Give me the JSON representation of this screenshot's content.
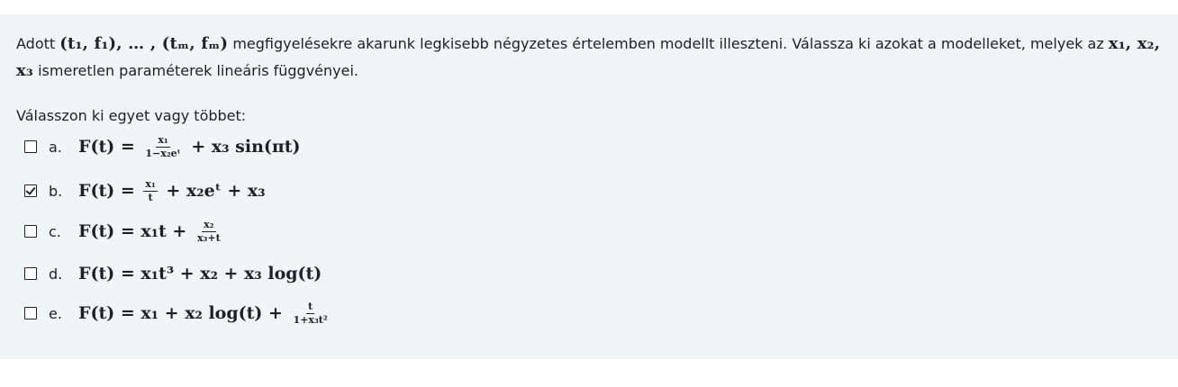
{
  "question": {
    "text_before": "Adott ",
    "math_observations": "(t₁, f₁), … , (tₘ, fₘ)",
    "text_middle": " megfigyelésekre akarunk legkisebb négyzetes értelemben modellt illeszteni. Válassza ki azokat a modelleket, melyek az ",
    "math_params": "x₁, x₂, x₃",
    "text_after": " ismeretlen paraméterek lineáris függvényei.",
    "instruction": "Válasszon ki egyet vagy többet:"
  },
  "options": [
    {
      "label": "a.",
      "checked": false,
      "lhs": "F(t) = ",
      "frac_num": "x₁",
      "frac_den": "1−x₂eᵗ",
      "rest": " + x₃ sin(πt)"
    },
    {
      "label": "b.",
      "checked": true,
      "lhs": "F(t) = ",
      "frac_num": "x₁",
      "frac_den": "t",
      "rest": " + x₂eᵗ + x₃"
    },
    {
      "label": "c.",
      "checked": false,
      "lhs": "F(t) = x₁t + ",
      "frac_num": "x₂",
      "frac_den": "x₃+t",
      "rest": ""
    },
    {
      "label": "d.",
      "checked": false,
      "lhs": "F(t) = x₁t³ + x₂ + x₃ log(t)",
      "frac_num": "",
      "frac_den": "",
      "rest": ""
    },
    {
      "label": "e.",
      "checked": false,
      "lhs": "F(t) = x₁ + x₂ log(t) + ",
      "frac_num": "t",
      "frac_den": "1+x₃t²",
      "rest": ""
    }
  ]
}
